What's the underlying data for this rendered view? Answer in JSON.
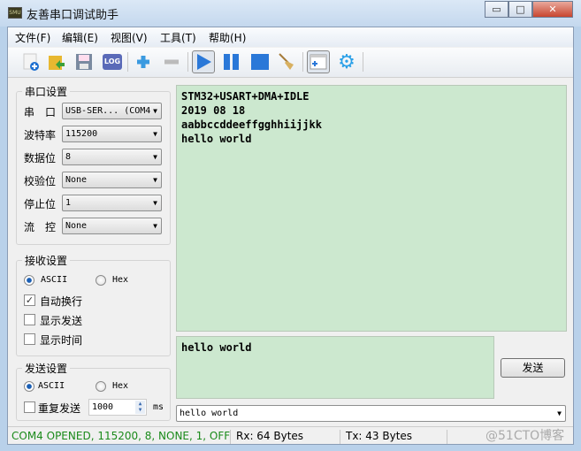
{
  "window": {
    "title": "友善串口调试助手",
    "icon_text": "SMU",
    "minimize": "▭",
    "maximize": "□",
    "close": "✕"
  },
  "menu": [
    "文件(F)",
    "编辑(E)",
    "视图(V)",
    "工具(T)",
    "帮助(H)"
  ],
  "toolbar": [
    "new-file-icon",
    "open-folder-icon",
    "save-icon",
    "log-icon",
    "add-icon",
    "remove-icon",
    "play-icon",
    "pause-icon",
    "stop-icon",
    "broom-clear-icon",
    "add-window-icon",
    "gear-icon"
  ],
  "toolbar_log_text": "LOG",
  "serial_settings": {
    "title": "串口设置",
    "fields": [
      {
        "label": "串　口",
        "value": "USB-SER... (COM4"
      },
      {
        "label": "波特率",
        "value": "115200"
      },
      {
        "label": "数据位",
        "value": "8"
      },
      {
        "label": "校验位",
        "value": "None"
      },
      {
        "label": "停止位",
        "value": "1"
      },
      {
        "label": "流　控",
        "value": "None"
      }
    ]
  },
  "receive_settings": {
    "title": "接收设置",
    "ascii": "ASCII",
    "hex": "Hex",
    "selected": "ASCII",
    "auto_wrap": "自动换行",
    "auto_wrap_checked": true,
    "show_send": "显示发送",
    "show_send_checked": false,
    "show_time": "显示时间",
    "show_time_checked": false
  },
  "send_settings": {
    "title": "发送设置",
    "ascii": "ASCII",
    "hex": "Hex",
    "selected": "ASCII",
    "repeat": "重复发送",
    "repeat_checked": false,
    "interval": "1000",
    "unit": "ms"
  },
  "receive_text": "STM32+USART+DMA+IDLE\n2019 08 18\naabbccddeeffgghhiijjkk\nhello world",
  "send_text": "hello world",
  "send_button": "发送",
  "history_value": "hello world",
  "status": {
    "port": "COM4 OPENED, 115200, 8, NONE, 1, OFF",
    "rx": "Rx: 64 Bytes",
    "tx": "Tx: 43 Bytes",
    "watermark": "@51CTO博客"
  },
  "colors": {
    "status_ok": "#1a8a1a",
    "text_bg": "#cce8cf",
    "accent": "#1f6fd0"
  }
}
